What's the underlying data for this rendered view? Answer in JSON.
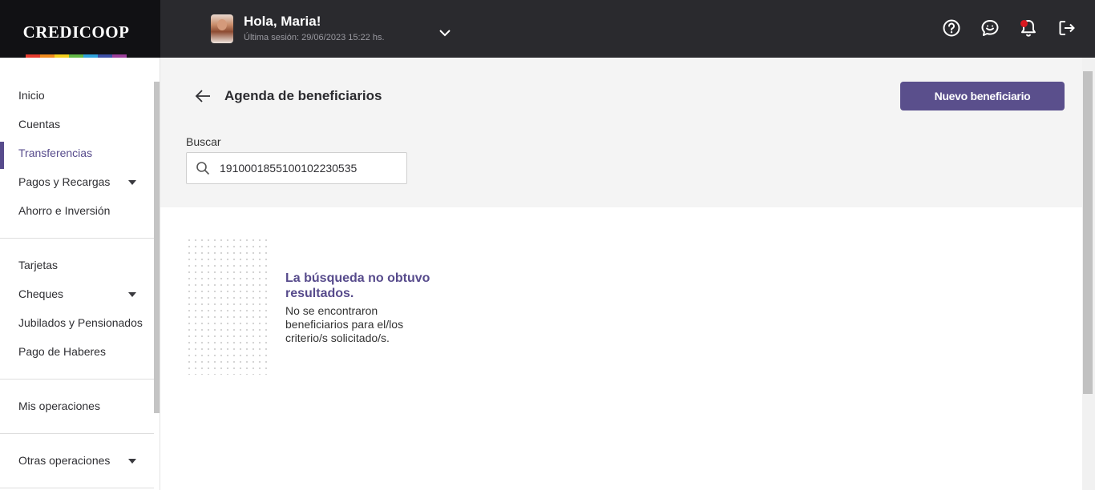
{
  "brand": {
    "name": "CREDICOOP",
    "stripe_colors": [
      "#e63b2e",
      "#f08a1c",
      "#f4cf1d",
      "#62b845",
      "#2fa3dd",
      "#3c4fa6",
      "#9b3e9a"
    ]
  },
  "header": {
    "greeting": "Hola, Maria!",
    "last_session": "Última sesión: 29/06/2023 15:22 hs.",
    "icons": [
      "help-icon",
      "chat-icon",
      "bell-icon",
      "logout-icon"
    ]
  },
  "sidebar": {
    "active_color": "#574b8c",
    "items": [
      {
        "label": "Inicio"
      },
      {
        "label": "Cuentas"
      },
      {
        "label": "Transferencias",
        "active": true
      },
      {
        "label": "Pagos y Recargas",
        "expandable": true
      },
      {
        "label": "Ahorro e Inversión"
      },
      {
        "label": "Tarjetas"
      },
      {
        "label": "Cheques",
        "expandable": true
      },
      {
        "label": "Jubilados y Pensionados"
      },
      {
        "label": "Pago de Haberes"
      },
      {
        "label": "Mis operaciones"
      },
      {
        "label": "Otras operaciones",
        "expandable": true
      }
    ]
  },
  "page": {
    "title": "Agenda de beneficiarios",
    "new_button": "Nuevo beneficiario",
    "accent_color": "#5a4f8c"
  },
  "search": {
    "label": "Buscar",
    "value": "1910001855100102230535"
  },
  "empty_state": {
    "title": "La búsqueda no obtuvo resultados.",
    "description": "No se encontraron beneficiarios para el/los criterio/s solicitado/s."
  }
}
